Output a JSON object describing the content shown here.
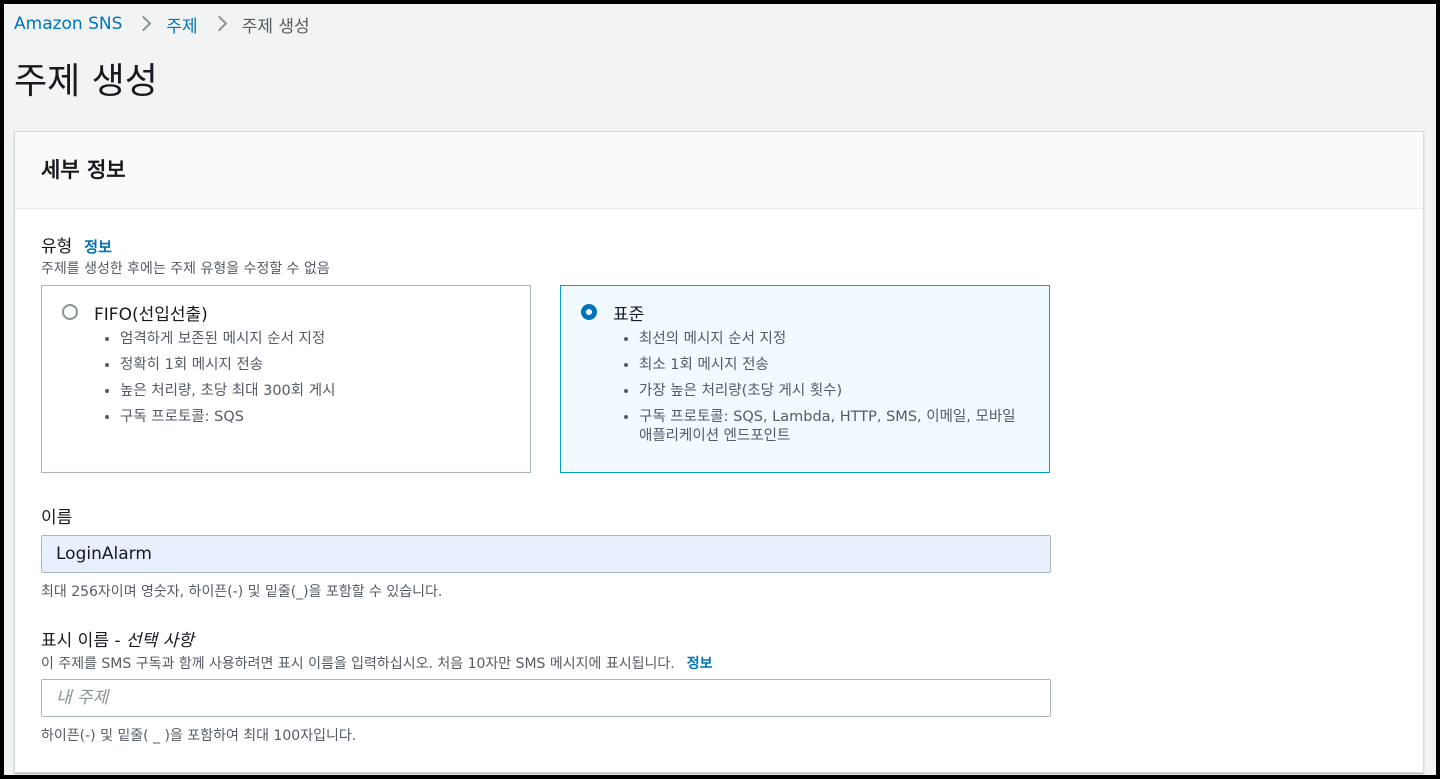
{
  "breadcrumb": {
    "items": [
      "Amazon SNS",
      "주제",
      "주제 생성"
    ]
  },
  "page": {
    "title": "주제 생성"
  },
  "details": {
    "heading": "세부 정보",
    "type": {
      "label": "유형",
      "info": "정보",
      "description": "주제를 생성한 후에는 주제 유형을 수정할 수 없음",
      "selected": "standard",
      "options": [
        {
          "id": "fifo",
          "title": "FIFO(선입선출)",
          "bullets": [
            "엄격하게 보존된 메시지 순서 지정",
            "정확히 1회 메시지 전송",
            "높은 처리량, 초당 최대 300회 게시",
            "구독 프로토콜: SQS"
          ]
        },
        {
          "id": "standard",
          "title": "표준",
          "bullets": [
            "최선의 메시지 순서 지정",
            "최소 1회 메시지 전송",
            "가장 높은 처리량(초당 게시 횟수)",
            "구독 프로토콜: SQS, Lambda, HTTP, SMS, 이메일, 모바일 애플리케이션 엔드포인트"
          ]
        }
      ]
    },
    "name": {
      "label": "이름",
      "value": "LoginAlarm",
      "hint": "최대 256자이며 영숫자, 하이픈(-) 및 밑줄(_)을 포함할 수 있습니다."
    },
    "display_name": {
      "label": "표시 이름 - ",
      "optional": "선택 사항",
      "description": "이 주제를 SMS 구독과 함께 사용하려면 표시 이름을 입력하십시오. 처음 10자만 SMS 메시지에 표시됩니다.",
      "info": "정보",
      "placeholder": "내 주제",
      "value": "",
      "hint": "하이픈(-) 및 밑줄( _ )을 포함하여 최대 100자입니다."
    }
  },
  "colors": {
    "link": "#0073bb",
    "selected_border": "#00a1c9",
    "selected_bg": "#f1faff",
    "autofill_bg": "#e8f0fe"
  }
}
